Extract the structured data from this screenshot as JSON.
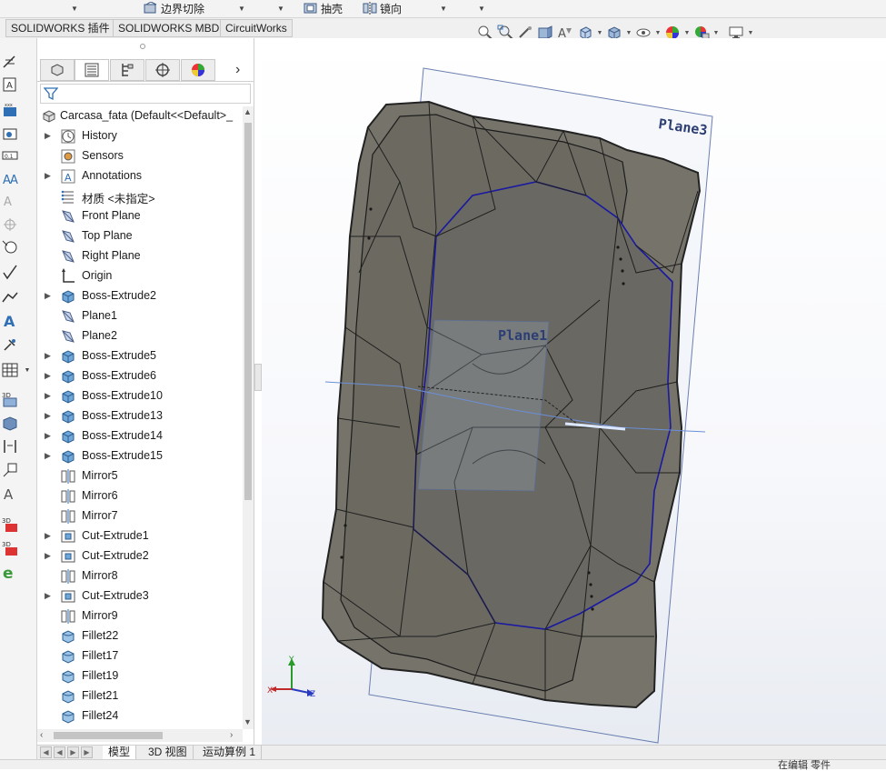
{
  "toolbar": {
    "boundary_cut": "边界切除",
    "shell": "抽壳",
    "mirror": "镜向"
  },
  "tabs": [
    "SOLIDWORKS 插件",
    "SOLIDWORKS MBD",
    "CircuitWorks"
  ],
  "view_icons": [
    "zoom-to-fit-icon",
    "zoom-area-icon",
    "previous-view-icon",
    "section-view-icon",
    "dynamic-annotation-icon",
    "view-orientation-icon",
    "display-style-icon",
    "hide-show-icon",
    "edit-appearance-icon",
    "apply-scene-icon",
    "view-settings-icon"
  ],
  "feature_tree": {
    "root": "Carcasa_fata  (Default<<Default>_",
    "nodes": [
      {
        "label": "History",
        "icon": "history-icon",
        "expandable": true
      },
      {
        "label": "Sensors",
        "icon": "sensors-icon",
        "expandable": false
      },
      {
        "label": "Annotations",
        "icon": "annotations-icon",
        "expandable": true
      },
      {
        "label": "材质 <未指定>",
        "icon": "material-icon",
        "expandable": false
      },
      {
        "label": "Front Plane",
        "icon": "plane-icon",
        "expandable": false
      },
      {
        "label": "Top Plane",
        "icon": "plane-icon",
        "expandable": false
      },
      {
        "label": "Right Plane",
        "icon": "plane-icon",
        "expandable": false
      },
      {
        "label": "Origin",
        "icon": "origin-icon",
        "expandable": false
      },
      {
        "label": "Boss-Extrude2",
        "icon": "extrude-icon",
        "expandable": true
      },
      {
        "label": "Plane1",
        "icon": "plane-icon",
        "expandable": false
      },
      {
        "label": "Plane2",
        "icon": "plane-icon",
        "expandable": false
      },
      {
        "label": "Boss-Extrude5",
        "icon": "extrude-icon",
        "expandable": true
      },
      {
        "label": "Boss-Extrude6",
        "icon": "extrude-icon",
        "expandable": true
      },
      {
        "label": "Boss-Extrude10",
        "icon": "extrude-icon",
        "expandable": true
      },
      {
        "label": "Boss-Extrude13",
        "icon": "extrude-icon",
        "expandable": true
      },
      {
        "label": "Boss-Extrude14",
        "icon": "extrude-icon",
        "expandable": true
      },
      {
        "label": "Boss-Extrude15",
        "icon": "extrude-icon",
        "expandable": true
      },
      {
        "label": "Mirror5",
        "icon": "mirror-icon",
        "expandable": false
      },
      {
        "label": "Mirror6",
        "icon": "mirror-icon",
        "expandable": false
      },
      {
        "label": "Mirror7",
        "icon": "mirror-icon",
        "expandable": false
      },
      {
        "label": "Cut-Extrude1",
        "icon": "cut-extrude-icon",
        "expandable": true
      },
      {
        "label": "Cut-Extrude2",
        "icon": "cut-extrude-icon",
        "expandable": true
      },
      {
        "label": "Mirror8",
        "icon": "mirror-icon",
        "expandable": false
      },
      {
        "label": "Cut-Extrude3",
        "icon": "cut-extrude-icon",
        "expandable": true
      },
      {
        "label": "Mirror9",
        "icon": "mirror-icon",
        "expandable": false
      },
      {
        "label": "Fillet22",
        "icon": "fillet-icon",
        "expandable": false
      },
      {
        "label": "Fillet17",
        "icon": "fillet-icon",
        "expandable": false
      },
      {
        "label": "Fillet19",
        "icon": "fillet-icon",
        "expandable": false
      },
      {
        "label": "Fillet21",
        "icon": "fillet-icon",
        "expandable": false
      },
      {
        "label": "Fillet24",
        "icon": "fillet-icon",
        "expandable": false
      }
    ]
  },
  "bottom_tabs": [
    "模型",
    "3D 视图",
    "运动算例 1"
  ],
  "status": "在编辑 零件",
  "viewport": {
    "plane3_label": "Plane3",
    "plane1_label": "Plane1",
    "axis_x": "X",
    "axis_y": "Y",
    "axis_z": "Z"
  },
  "colors": {
    "model_face": "#76746a",
    "sketch": "#1a1aa0",
    "plane_edge": "#6a7fb0"
  }
}
